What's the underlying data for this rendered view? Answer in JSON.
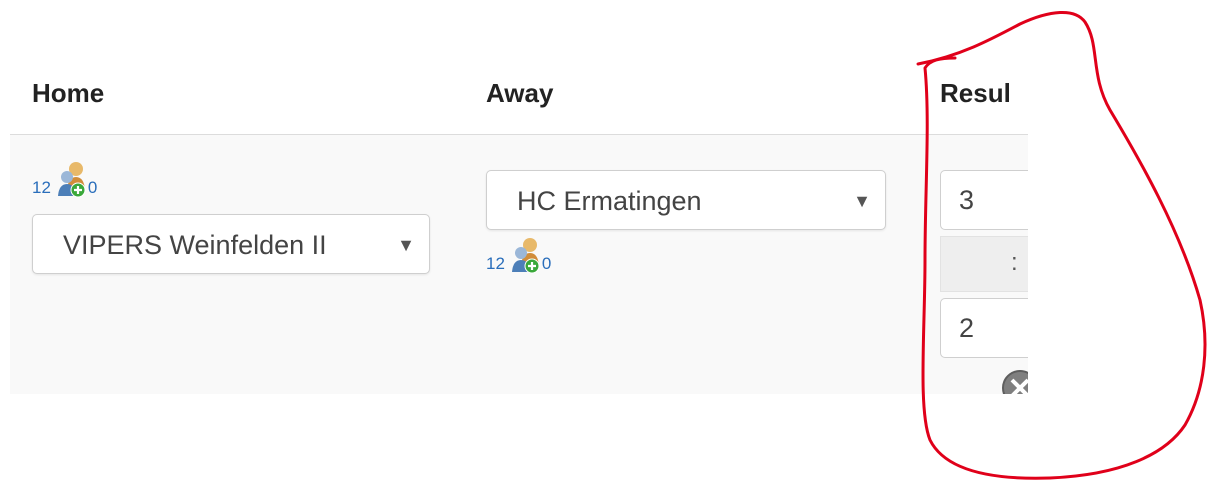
{
  "headers": {
    "home": "Home",
    "away": "Away",
    "result": "Resul"
  },
  "home": {
    "count_left": "12",
    "count_right": "0",
    "team_select": {
      "value": "VIPERS Weinfelden II",
      "caret": "▼"
    }
  },
  "away": {
    "team_select": {
      "value": "HC Ermatingen",
      "caret": "▼"
    },
    "count_left": "12",
    "count_right": "0"
  },
  "result": {
    "home_score": "3",
    "separator": ":",
    "away_score": "2"
  },
  "icons": {
    "players": "players-add-icon",
    "clear": "clear-icon"
  },
  "colors": {
    "link_blue": "#2a6ebb",
    "annotation_red": "#e0001a"
  }
}
